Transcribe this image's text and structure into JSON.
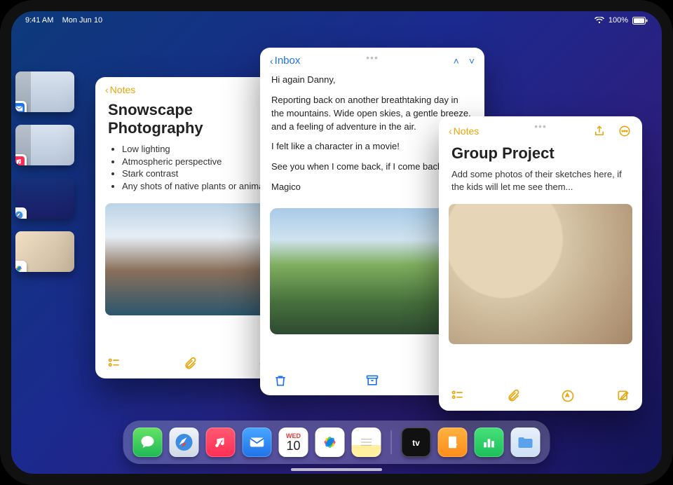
{
  "statusbar": {
    "time": "9:41 AM",
    "date": "Mon Jun 10",
    "battery": "100%"
  },
  "stage_strip": {
    "tiles": [
      {
        "app": "Mail"
      },
      {
        "app": "Music"
      },
      {
        "app": "Safari"
      },
      {
        "app": "Photos"
      }
    ]
  },
  "windows": {
    "notes_snowscape": {
      "back_label": "Notes",
      "title": "Snowscape Photography",
      "bullets": [
        "Low lighting",
        "Atmospheric perspective",
        "Stark contrast",
        "Any shots of native plants or animals"
      ]
    },
    "mail": {
      "back_label": "Inbox",
      "greeting": "Hi again Danny,",
      "p1": "Reporting back on another breathtaking day in the mountains. Wide open skies, a gentle breeze, and a feeling of adventure in the air.",
      "p2": "I felt like a character in a movie!",
      "p3": "See you when I come back, if I come back. 😉",
      "signoff": "Magico"
    },
    "notes_group": {
      "back_label": "Notes",
      "title": "Group Project",
      "body": "Add some photos of their sketches here, if the kids will let me see them..."
    }
  },
  "dock": {
    "calendar_weekday": "WED",
    "calendar_day": "10",
    "apps": [
      "Messages",
      "Safari",
      "Music",
      "Mail",
      "Calendar",
      "Photos",
      "Notes",
      "TV",
      "Pages",
      "Numbers",
      "Files"
    ]
  }
}
